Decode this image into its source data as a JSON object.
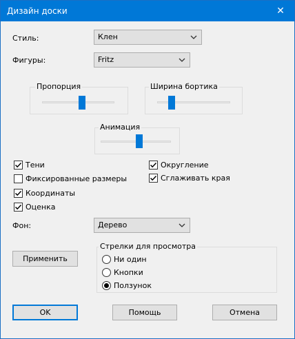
{
  "window": {
    "title": "Дизайн доски",
    "accent": "#0078d7"
  },
  "style": {
    "label": "Стиль:",
    "value": "Клен"
  },
  "pieces": {
    "label": "Фигуры:",
    "value": "Fritz"
  },
  "proportion": {
    "label": "Пропорция",
    "level": 0.55
  },
  "border_width": {
    "label": "Ширина бортика",
    "level": 0.2
  },
  "animation": {
    "label": "Анимация",
    "level": 0.55
  },
  "checkboxes": {
    "shadows": {
      "label": "Тени",
      "checked": true
    },
    "fixed_sizes": {
      "label": "Фиксированные размеры",
      "checked": false
    },
    "coordinates": {
      "label": "Координаты",
      "checked": true
    },
    "evaluation": {
      "label": "Оценка",
      "checked": true
    },
    "rounding": {
      "label": "Округление",
      "checked": true
    },
    "smooth_edges": {
      "label": "Сглаживать края",
      "checked": true
    }
  },
  "background": {
    "label": "Фон:",
    "value": "Дерево"
  },
  "apply_label": "Применить",
  "arrows": {
    "title": "Стрелки для просмотра",
    "options": [
      {
        "label": "Ни один",
        "selected": false
      },
      {
        "label": "Кнопки",
        "selected": false
      },
      {
        "label": "Ползунок",
        "selected": true
      }
    ]
  },
  "buttons": {
    "ok": "OK",
    "help": "Помощь",
    "cancel": "Отмена"
  }
}
